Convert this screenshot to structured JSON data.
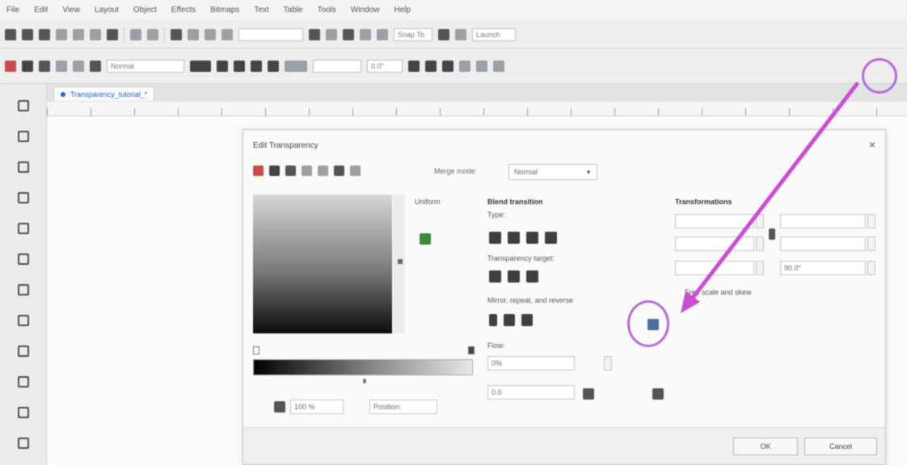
{
  "menubar": {
    "items": [
      "File",
      "Edit",
      "View",
      "Layout",
      "Object",
      "Effects",
      "Bitmaps",
      "Text",
      "Table",
      "Tools",
      "Window",
      "Help"
    ]
  },
  "toolbar1": {
    "zoom_value": "",
    "snap_label": "Snap To",
    "launch_label": "Launch"
  },
  "toolbar2": {
    "merge_mode": "Normal",
    "angle_value": "",
    "rotation_value": "0.0°"
  },
  "doc_tab": {
    "label": "Transparency_tutorial_*"
  },
  "dialog": {
    "title": "Edit Transparency",
    "close_glyph": "×",
    "merge_mode_label": "Merge mode:",
    "merge_mode_value": "Normal",
    "uniform_label": "Uniform",
    "blend_label": "Blend transition",
    "type_label": "Type:",
    "target_label": "Transparency target:",
    "mirror_label": "Mirror, repeat, and reverse",
    "flow_label": "Flow:",
    "flow_value": "0%",
    "accel_value": "0.0",
    "transparency_value": "100 %",
    "position_label": "Position:",
    "transformations_label": "Transformations",
    "width_value": "",
    "height_value": "",
    "x_value": "",
    "y_value": "",
    "angle_value": "90.0°",
    "free_scale_label": "Free scale and skew",
    "ok_label": "OK",
    "cancel_label": "Cancel"
  },
  "accent_color": "#c94fd0"
}
